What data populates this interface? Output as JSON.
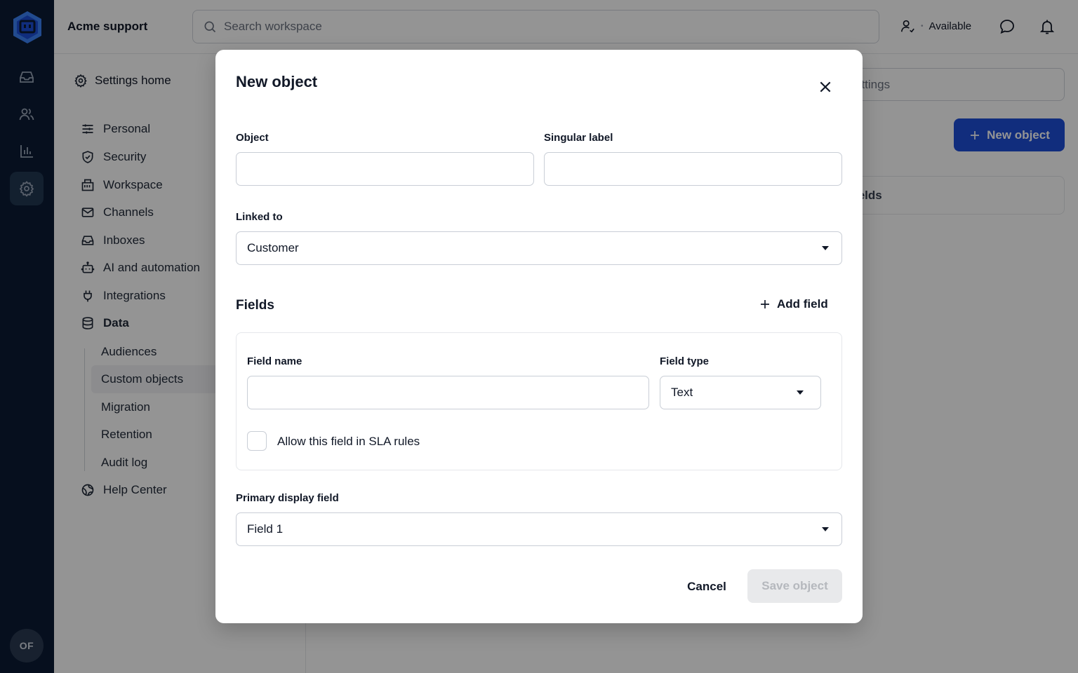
{
  "app": {
    "brand": "Acme support",
    "avatar_initials": "OF"
  },
  "topbar": {
    "search_placeholder": "Search workspace",
    "status": "Available"
  },
  "rail": {
    "icons": [
      "logo-icon",
      "inbox-icon",
      "contacts-icon",
      "reports-icon",
      "settings-icon"
    ],
    "active": "settings-icon"
  },
  "settings_sidebar": {
    "home_label": "Settings home",
    "items": [
      {
        "label": "Personal",
        "icon": "sliders-icon"
      },
      {
        "label": "Security",
        "icon": "shield-icon"
      },
      {
        "label": "Workspace",
        "icon": "building-icon"
      },
      {
        "label": "Channels",
        "icon": "mail-icon"
      },
      {
        "label": "Inboxes",
        "icon": "inbox-icon"
      },
      {
        "label": "AI and automation",
        "icon": "robot-icon"
      },
      {
        "label": "Integrations",
        "icon": "plug-icon"
      },
      {
        "label": "Data",
        "icon": "database-icon"
      },
      {
        "label": "Help Center",
        "icon": "globe-icon"
      }
    ],
    "data_children": [
      "Audiences",
      "Custom objects",
      "Migration",
      "Retention",
      "Audit log"
    ],
    "active_child": "Custom objects"
  },
  "main": {
    "search_placeholder_partial": "ettings",
    "new_object_label": "New object",
    "tab_partial": "ields"
  },
  "modal": {
    "title": "New object",
    "object_label": "Object",
    "object_value": "",
    "singular_label": "Singular label",
    "singular_value": "",
    "linked_to_label": "Linked to",
    "linked_to_value": "Customer",
    "fields_title": "Fields",
    "add_field_label": "Add field",
    "field_name_label": "Field name",
    "field_name_value": "",
    "field_type_label": "Field type",
    "field_type_value": "Text",
    "sla_checkbox_label": "Allow this field in SLA rules",
    "sla_checked": false,
    "primary_display_label": "Primary display field",
    "primary_display_value": "Field 1",
    "cancel_label": "Cancel",
    "save_label": "Save object",
    "save_disabled": true
  },
  "colors": {
    "rail_bg": "#0b1b34",
    "accent": "#1e4fd8",
    "overlay": "rgba(0,0,0,0.42)"
  }
}
